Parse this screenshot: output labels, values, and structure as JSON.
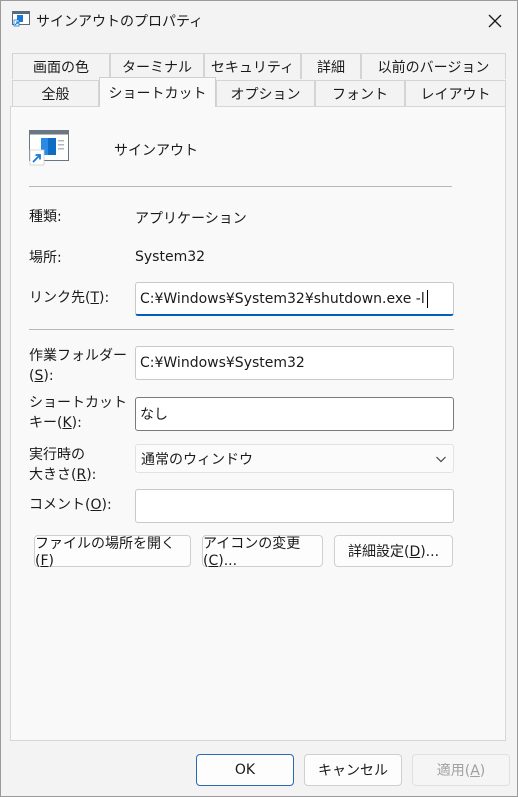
{
  "window": {
    "title": "サインアウトのプロパティ"
  },
  "tabs": {
    "row1": [
      {
        "label": "画面の色"
      },
      {
        "label": "ターミナル"
      },
      {
        "label": "セキュリティ"
      },
      {
        "label": "詳細"
      },
      {
        "label": "以前のバージョン"
      }
    ],
    "row2": [
      {
        "label": "全般"
      },
      {
        "label": "ショートカット"
      },
      {
        "label": "オプション"
      },
      {
        "label": "フォント"
      },
      {
        "label": "レイアウト"
      }
    ],
    "active": "ショートカット"
  },
  "shortcut": {
    "name": "サインアウト",
    "type_label": "種類:",
    "type_value": "アプリケーション",
    "location_label": "場所:",
    "location_value": "System32",
    "target_label_pre": "リンク先(",
    "target_label_key": "T",
    "target_label_post": "):",
    "target_value": "C:¥Windows¥System32¥shutdown.exe -l",
    "startin_label_line1": "作業フォルダー",
    "startin_label_pre": "(",
    "startin_label_key": "S",
    "startin_label_post": "):",
    "startin_value": "C:¥Windows¥System32",
    "hotkey_label_line1": "ショートカット",
    "hotkey_label_pre": "キー(",
    "hotkey_label_key": "K",
    "hotkey_label_post": "):",
    "hotkey_value": "なし",
    "run_label_line1": "実行時の",
    "run_label_pre": "大きさ(",
    "run_label_key": "R",
    "run_label_post": "):",
    "run_value": "通常のウィンドウ",
    "comment_label_pre": "コメント(",
    "comment_label_key": "O",
    "comment_label_post": "):",
    "comment_value": ""
  },
  "actions": {
    "open_location_pre": "ファイルの場所を開く(",
    "open_location_key": "F",
    "open_location_post": ")",
    "change_icon_pre": "アイコンの変更(",
    "change_icon_key": "C",
    "change_icon_post": ")...",
    "advanced_pre": "詳細設定(",
    "advanced_key": "D",
    "advanced_post": ")..."
  },
  "footer": {
    "ok_label": "OK",
    "cancel_label": "キャンセル",
    "apply_pre": "適用(",
    "apply_key": "A",
    "apply_post": ")"
  },
  "icons": {
    "title_icon": "shortcut-icon",
    "app_icon": "signout-shortcut-icon",
    "close": "close-icon",
    "dropdown": "chevron-down-icon"
  }
}
